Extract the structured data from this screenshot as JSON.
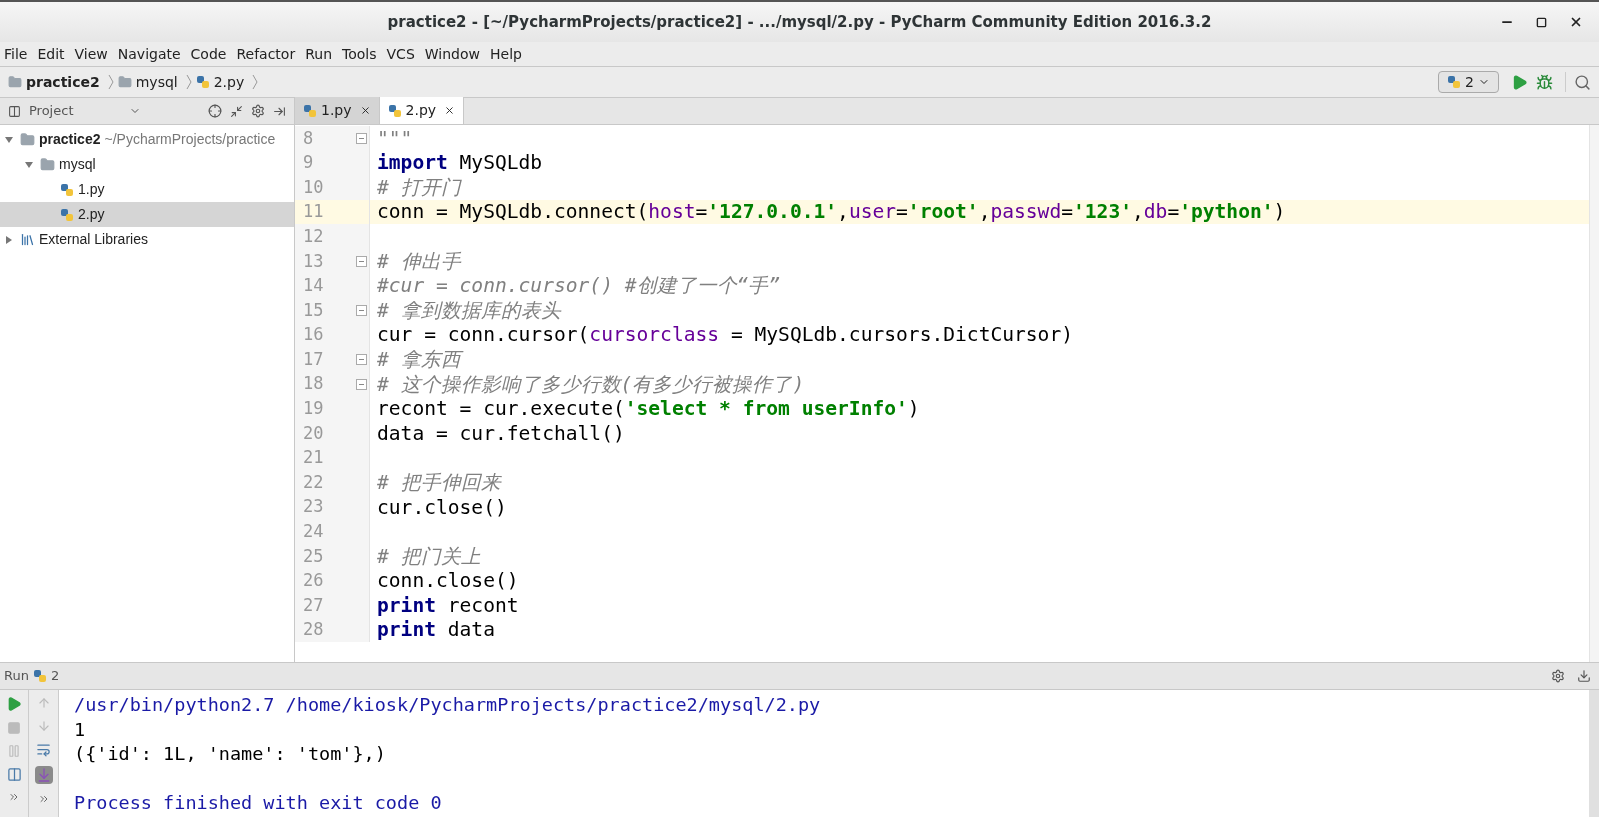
{
  "window": {
    "title": "practice2 - [~/PycharmProjects/practice2] - .../mysql/2.py - PyCharm Community Edition 2016.3.2"
  },
  "menu": [
    "File",
    "Edit",
    "View",
    "Navigate",
    "Code",
    "Refactor",
    "Run",
    "Tools",
    "VCS",
    "Window",
    "Help"
  ],
  "breadcrumbs": [
    {
      "label": "practice2",
      "kind": "folder"
    },
    {
      "label": "mysql",
      "kind": "folder"
    },
    {
      "label": "2.py",
      "kind": "file"
    }
  ],
  "run_config": {
    "label": "2"
  },
  "project": {
    "header": "Project",
    "tree": [
      {
        "label": "practice2",
        "path": "~/PycharmProjects/practice",
        "kind": "folder",
        "expanded": true,
        "selected": false,
        "children": [
          {
            "label": "mysql",
            "kind": "folder",
            "expanded": true,
            "selected": false,
            "children": [
              {
                "label": "1.py",
                "kind": "file",
                "selected": false
              },
              {
                "label": "2.py",
                "kind": "file",
                "selected": true
              }
            ]
          }
        ]
      },
      {
        "label": "External Libraries",
        "kind": "library",
        "expanded": false,
        "selected": false
      }
    ]
  },
  "tabs": [
    {
      "label": "1.py",
      "selected": false
    },
    {
      "label": "2.py",
      "selected": true
    }
  ],
  "editor": {
    "lines": [
      {
        "number": "8",
        "current": false,
        "fold": true,
        "tokens": [
          {
            "kind": "doc",
            "text": "\"\"\""
          }
        ]
      },
      {
        "number": "9",
        "current": false,
        "fold": false,
        "tokens": [
          {
            "kind": "kw",
            "text": "import"
          },
          {
            "kind": "plain",
            "text": " MySQLdb"
          }
        ]
      },
      {
        "number": "10",
        "current": false,
        "fold": false,
        "tokens": [
          {
            "kind": "comment",
            "text": "# 打开门"
          }
        ]
      },
      {
        "number": "11",
        "current": true,
        "fold": false,
        "tokens": [
          {
            "kind": "plain",
            "text": "conn = MySQLdb.connect("
          },
          {
            "kind": "param",
            "text": "host"
          },
          {
            "kind": "plain",
            "text": "="
          },
          {
            "kind": "str",
            "text": "'127.0.0.1'"
          },
          {
            "kind": "plain",
            "text": ","
          },
          {
            "kind": "param",
            "text": "user"
          },
          {
            "kind": "plain",
            "text": "="
          },
          {
            "kind": "str",
            "text": "'root'"
          },
          {
            "kind": "plain",
            "text": ","
          },
          {
            "kind": "param",
            "text": "passwd"
          },
          {
            "kind": "plain",
            "text": "="
          },
          {
            "kind": "str",
            "text": "'123'"
          },
          {
            "kind": "plain",
            "text": ","
          },
          {
            "kind": "param",
            "text": "db"
          },
          {
            "kind": "plain",
            "text": "="
          },
          {
            "kind": "str",
            "text": "'python'"
          },
          {
            "kind": "plain",
            "text": ")"
          }
        ]
      },
      {
        "number": "12",
        "current": false,
        "fold": false
      },
      {
        "number": "13",
        "current": false,
        "fold": true,
        "tokens": [
          {
            "kind": "comment",
            "text": "# 伸出手"
          }
        ]
      },
      {
        "number": "14",
        "current": false,
        "fold": false,
        "tokens": [
          {
            "kind": "comment",
            "text": "#cur = conn.cursor() #创建了一个“手”"
          }
        ]
      },
      {
        "number": "15",
        "current": false,
        "fold": true,
        "tokens": [
          {
            "kind": "comment",
            "text": "# 拿到数据库的表头"
          }
        ]
      },
      {
        "number": "16",
        "current": false,
        "fold": false,
        "tokens": [
          {
            "kind": "plain",
            "text": "cur = conn.cursor("
          },
          {
            "kind": "param",
            "text": "cursorclass"
          },
          {
            "kind": "plain",
            "text": " = MySQLdb.cursors.DictCursor)"
          }
        ]
      },
      {
        "number": "17",
        "current": false,
        "fold": true,
        "tokens": [
          {
            "kind": "comment",
            "text": "# 拿东西"
          }
        ]
      },
      {
        "number": "18",
        "current": false,
        "fold": true,
        "tokens": [
          {
            "kind": "comment",
            "text": "# 这个操作影响了多少行数(有多少行被操作了)"
          }
        ]
      },
      {
        "number": "19",
        "current": false,
        "fold": false,
        "tokens": [
          {
            "kind": "plain",
            "text": "recont = cur.execute("
          },
          {
            "kind": "str",
            "text": "'select * from userInfo'"
          },
          {
            "kind": "plain",
            "text": ")"
          }
        ]
      },
      {
        "number": "20",
        "current": false,
        "fold": false,
        "tokens": [
          {
            "kind": "plain",
            "text": "data = cur.fetchall()"
          }
        ]
      },
      {
        "number": "21",
        "current": false,
        "fold": false
      },
      {
        "number": "22",
        "current": false,
        "fold": false,
        "tokens": [
          {
            "kind": "comment",
            "text": "# 把手伸回来"
          }
        ]
      },
      {
        "number": "23",
        "current": false,
        "fold": false,
        "tokens": [
          {
            "kind": "plain",
            "text": "cur.close()"
          }
        ]
      },
      {
        "number": "24",
        "current": false,
        "fold": false
      },
      {
        "number": "25",
        "current": false,
        "fold": false,
        "tokens": [
          {
            "kind": "comment",
            "text": "# 把门关上"
          }
        ]
      },
      {
        "number": "26",
        "current": false,
        "fold": false,
        "tokens": [
          {
            "kind": "plain",
            "text": "conn.close()"
          }
        ]
      },
      {
        "number": "27",
        "current": false,
        "fold": false,
        "tokens": [
          {
            "kind": "kw",
            "text": "print"
          },
          {
            "kind": "plain",
            "text": " recont"
          }
        ]
      },
      {
        "number": "28",
        "current": false,
        "fold": false,
        "tokens": [
          {
            "kind": "kw",
            "text": "print"
          },
          {
            "kind": "plain",
            "text": " data"
          }
        ]
      }
    ]
  },
  "run_panel": {
    "title": "Run",
    "config": "2",
    "output": [
      {
        "kind": "system",
        "text": "/usr/bin/python2.7 /home/kiosk/PycharmProjects/practice2/mysql/2.py"
      },
      {
        "kind": "stdout",
        "text": "1"
      },
      {
        "kind": "stdout",
        "text": "({'id': 1L, 'name': 'tom'},)"
      },
      {
        "kind": "blank"
      },
      {
        "kind": "system",
        "text": "Process finished with exit code 0"
      }
    ]
  }
}
